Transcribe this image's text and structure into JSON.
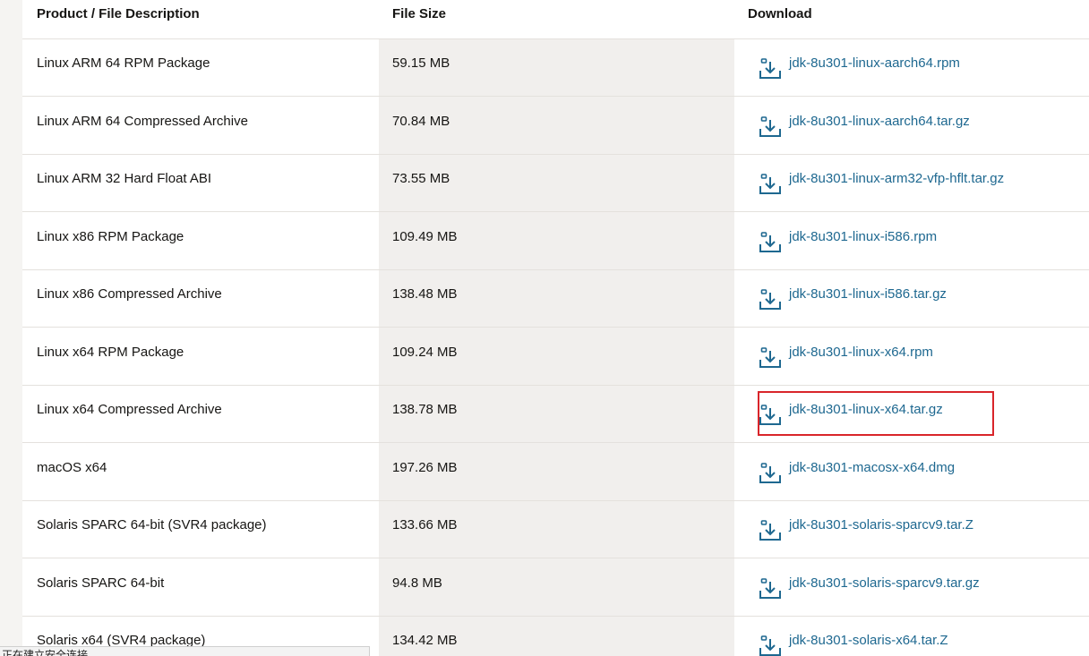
{
  "table": {
    "headers": {
      "description": "Product / File Description",
      "size": "File Size",
      "download": "Download"
    },
    "rows": [
      {
        "description": "Linux ARM 64 RPM Package",
        "size": "59.15 MB",
        "file": "jdk-8u301-linux-aarch64.rpm"
      },
      {
        "description": "Linux ARM 64 Compressed Archive",
        "size": "70.84 MB",
        "file": "jdk-8u301-linux-aarch64.tar.gz"
      },
      {
        "description": "Linux ARM 32 Hard Float ABI",
        "size": "73.55 MB",
        "file": "jdk-8u301-linux-arm32-vfp-hflt.tar.gz"
      },
      {
        "description": "Linux x86 RPM Package",
        "size": "109.49 MB",
        "file": "jdk-8u301-linux-i586.rpm"
      },
      {
        "description": "Linux x86 Compressed Archive",
        "size": "138.48 MB",
        "file": "jdk-8u301-linux-i586.tar.gz"
      },
      {
        "description": "Linux x64 RPM Package",
        "size": "109.24 MB",
        "file": "jdk-8u301-linux-x64.rpm"
      },
      {
        "description": "Linux x64 Compressed Archive",
        "size": "138.78 MB",
        "file": "jdk-8u301-linux-x64.tar.gz"
      },
      {
        "description": "macOS x64",
        "size": "197.26 MB",
        "file": "jdk-8u301-macosx-x64.dmg"
      },
      {
        "description": "Solaris SPARC 64-bit (SVR4 package)",
        "size": "133.66 MB",
        "file": "jdk-8u301-solaris-sparcv9.tar.Z"
      },
      {
        "description": "Solaris SPARC 64-bit",
        "size": "94.8 MB",
        "file": "jdk-8u301-solaris-sparcv9.tar.gz"
      },
      {
        "description": "Solaris x64 (SVR4 package)",
        "size": "134.42 MB",
        "file": "jdk-8u301-solaris-x64.tar.Z"
      }
    ]
  },
  "status_bar": {
    "text": "正在建立安全连接..."
  },
  "colors": {
    "link": "#1e6890",
    "highlight": "#d9252a",
    "shade": "#f1efed"
  },
  "icons": {
    "download": "download-icon"
  }
}
